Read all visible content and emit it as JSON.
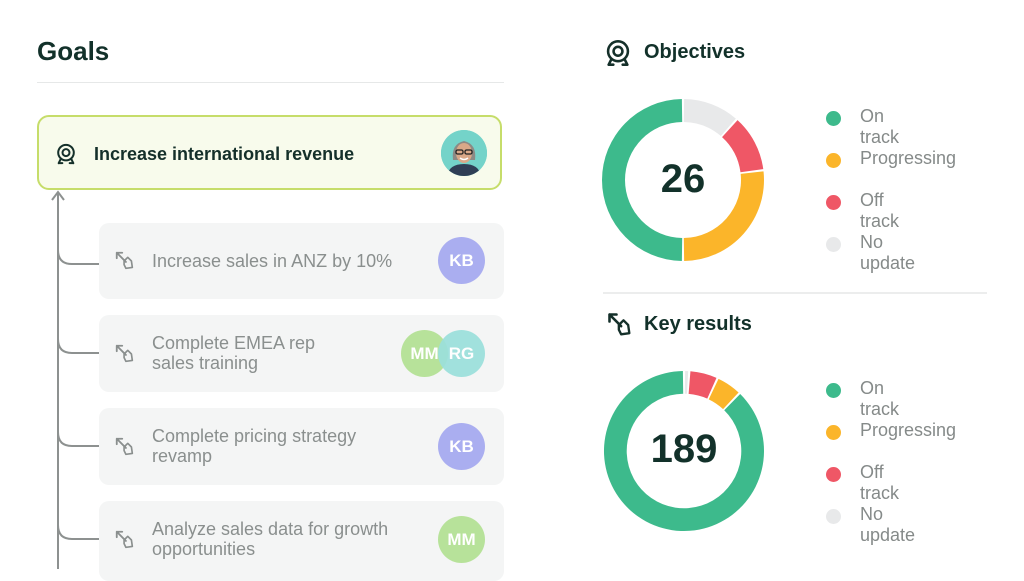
{
  "goals": {
    "title": "Goals",
    "parent": {
      "label": "Increase international revenue",
      "icon": "target-icon",
      "owner_avatar": "photo-avatar"
    },
    "children": [
      {
        "label": "Increase sales in ANZ by 10%",
        "icon": "dart-arrow-icon",
        "owners": [
          "KB"
        ]
      },
      {
        "label": "Complete EMEA rep sales training",
        "line1": "Complete EMEA rep",
        "line2": "sales training",
        "icon": "dart-arrow-icon",
        "owners": [
          "MM",
          "RG"
        ]
      },
      {
        "label": "Complete pricing strategy revamp",
        "line1": "Complete pricing strategy",
        "line2": "revamp",
        "icon": "dart-arrow-icon",
        "owners": [
          "KB"
        ]
      },
      {
        "label": "Analyze sales data for growth opportunities",
        "line1": "Analyze sales data for growth",
        "line2": "opportunities",
        "icon": "dart-arrow-icon",
        "owners": [
          "MM"
        ]
      }
    ]
  },
  "colors": {
    "on_track": "#3dba8c",
    "progressing": "#fbb52a",
    "off_track": "#ef5766",
    "no_update": "#e8e9ea",
    "accent_border": "#c6dd6a"
  },
  "chart_data": [
    {
      "type": "pie",
      "title": "Objectives",
      "total": "26",
      "categories": [
        "No update",
        "Off track",
        "Progressing",
        "On track"
      ],
      "values": [
        3,
        3,
        7,
        13
      ],
      "legend": [
        "On track",
        "Progressing",
        "Off track",
        "No update"
      ],
      "legend_position": "right"
    },
    {
      "type": "pie",
      "title": "Key results",
      "total": "189",
      "categories": [
        "No update",
        "Off track",
        "Progressing",
        "On track"
      ],
      "values": [
        2,
        11,
        10,
        166
      ],
      "legend": [
        "On track",
        "Progressing",
        "Off track",
        "No update"
      ],
      "legend_position": "right"
    }
  ]
}
